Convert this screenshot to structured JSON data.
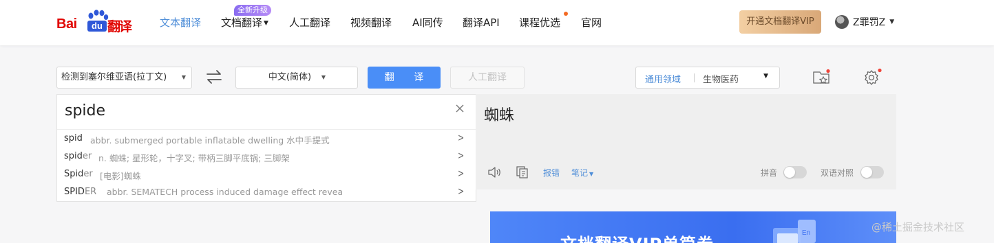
{
  "header": {
    "logo": {
      "bai": "Bai",
      "du": "du",
      "fanyi": "翻译"
    },
    "nav": [
      {
        "label": "文本翻译",
        "active": true
      },
      {
        "label": "文档翻译",
        "badge": "全新升级"
      },
      {
        "label": "人工翻译"
      },
      {
        "label": "视频翻译"
      },
      {
        "label": "AI同传"
      },
      {
        "label": "翻译API"
      },
      {
        "label": "课程优选"
      },
      {
        "label": "官网"
      }
    ],
    "vip_button": "开通文档翻译VIP",
    "user_name": "Z罪罚Z",
    "accent": "#4f8ed8"
  },
  "toolbar": {
    "source_language": "检测到塞尔维亚语(拉丁文)",
    "target_language": "中文(简体)",
    "translate_button": "翻 译",
    "human_translate_button": "人工翻译",
    "domain_general": "通用领域",
    "domain_selected": "生物医药",
    "icons": [
      "swap-icon",
      "favorites-icon",
      "settings-icon"
    ]
  },
  "input": {
    "query": "spide",
    "suggestions": [
      {
        "typed": "spid",
        "rest": "",
        "definition": "abbr. submerged portable inflatable dwelling 水中手提式"
      },
      {
        "typed": "spid",
        "rest": "er",
        "definition": "n. 蜘蛛; 星形轮，十字叉; 带柄三脚平底锅; 三脚架"
      },
      {
        "typed": "Spid",
        "rest": "er",
        "definition": "[电影]蜘蛛"
      },
      {
        "typed": "SPID",
        "rest": "ER",
        "definition": "abbr. SEMATECH process induced damage effect revea"
      }
    ]
  },
  "output": {
    "text": "蜘蛛",
    "report_link": "报错",
    "notes_link": "笔记",
    "pinyin_label": "拼音",
    "bilingual_label": "双语对照",
    "pinyin_on": false,
    "bilingual_on": false
  },
  "banner": {
    "title": "文档翻译VIP单篇券"
  },
  "watermark": "@稀土掘金技术社区"
}
